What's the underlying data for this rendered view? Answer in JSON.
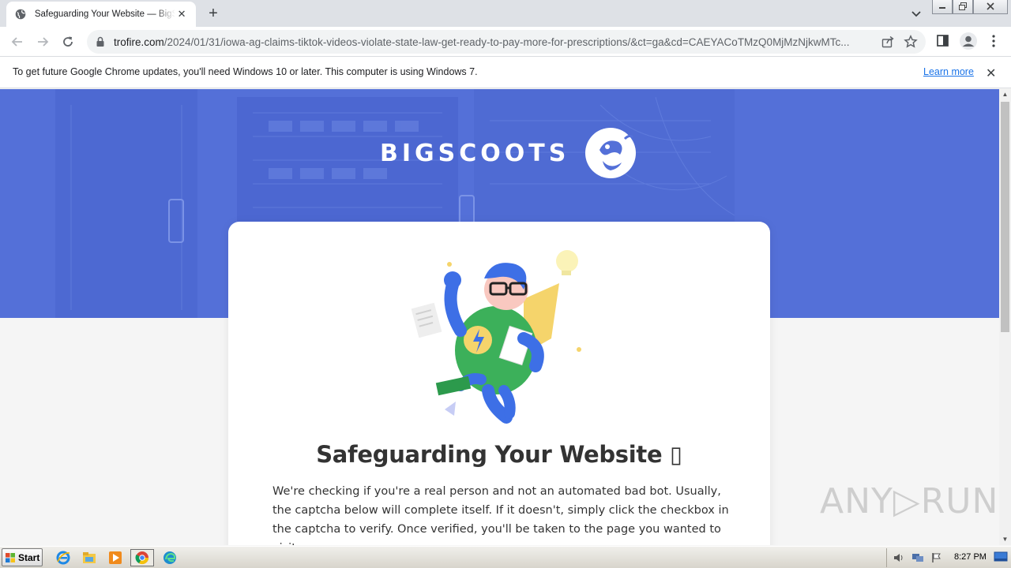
{
  "browser": {
    "tab_title": "Safeguarding Your Website — BigScoots",
    "new_tab_symbol": "+",
    "close_symbol": "✕",
    "url_host": "trofire.com",
    "url_path": "/2024/01/31/iowa-ag-claims-tiktok-videos-violate-state-law-get-ready-to-pay-more-for-prescriptions/&ct=ga&cd=CAEYACoTMzQ0MjMzNjkwMTc..."
  },
  "infobar": {
    "message": "To get future Google Chrome updates, you'll need Windows 10 or later. This computer is using Windows 7.",
    "link_label": "Learn more",
    "close_symbol": "✕"
  },
  "page": {
    "brand_name": "BIGSCOOTS",
    "heading": "Safeguarding Your Website ▯",
    "body": "We're checking if you're a real person and not an automated bad bot. Usually, the captcha below will complete itself. If it doesn't, simply click the checkbox in the captcha to verify. Once verified, you'll be taken to the page you wanted to visit.",
    "hero_color": "#5470d8",
    "watermark": "ANY▷RUN"
  },
  "taskbar": {
    "start_label": "Start",
    "clock": "8:27 PM"
  },
  "icons": {
    "tab_favicon": "globe-icon",
    "back": "back-arrow-icon",
    "forward": "forward-arrow-icon",
    "reload": "reload-icon",
    "lock": "lock-icon",
    "share": "share-icon",
    "star": "bookmark-star-icon",
    "sidepanel": "side-panel-icon",
    "profile": "profile-icon",
    "menu": "kebab-menu-icon"
  }
}
